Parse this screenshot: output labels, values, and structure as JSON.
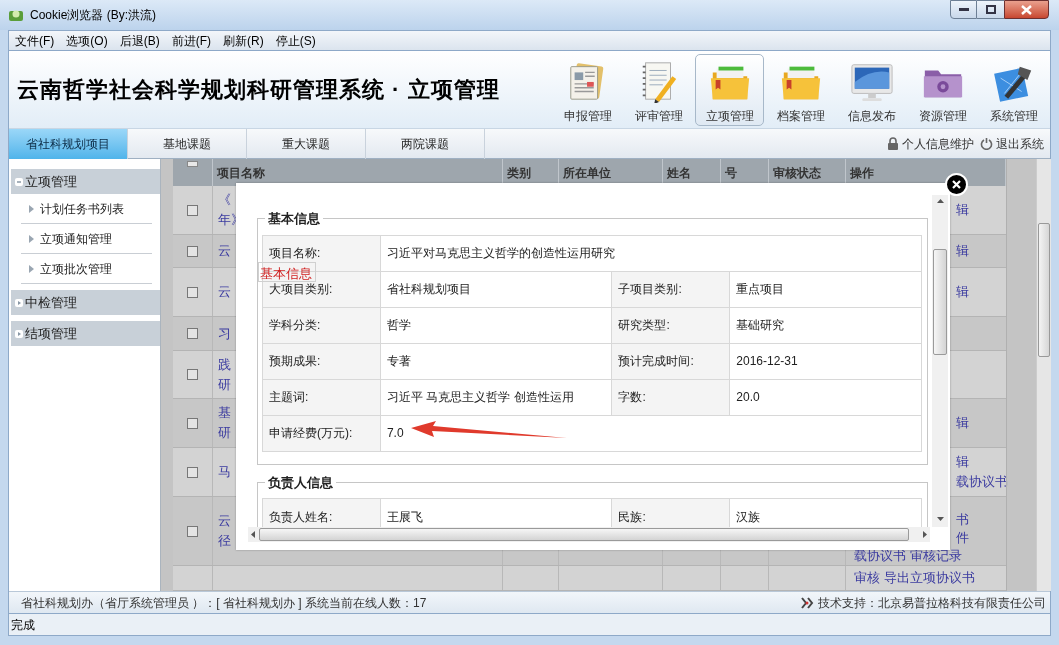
{
  "window": {
    "title": "Cookie浏览器 (By:洪流)"
  },
  "menu": [
    "文件(F)",
    "选项(O)",
    "后退(B)",
    "前进(F)",
    "刷新(R)",
    "停止(S)"
  ],
  "header": {
    "title": "云南哲学社会科学规划科研管理系统 · 立项管理",
    "nav": [
      {
        "label": "申报管理",
        "selected": false
      },
      {
        "label": "评审管理",
        "selected": false
      },
      {
        "label": "立项管理",
        "selected": true
      },
      {
        "label": "档案管理",
        "selected": false
      },
      {
        "label": "信息发布",
        "selected": false
      },
      {
        "label": "资源管理",
        "selected": false
      },
      {
        "label": "系统管理",
        "selected": false
      }
    ]
  },
  "tabs": [
    {
      "label": "省社科规划项目",
      "selected": true
    },
    {
      "label": "基地课题",
      "selected": false
    },
    {
      "label": "重大课题",
      "selected": false
    },
    {
      "label": "两院课题",
      "selected": false
    }
  ],
  "user_links": [
    "个人信息维护",
    "退出系统"
  ],
  "sidebar": [
    {
      "label": "立项管理",
      "expanded": true,
      "children": [
        {
          "label": "计划任务书列表"
        },
        {
          "label": "立项通知管理"
        },
        {
          "label": "立项批次管理"
        }
      ]
    },
    {
      "label": "中检管理",
      "expanded": false
    },
    {
      "label": "结项管理",
      "expanded": false
    }
  ],
  "table": {
    "select_all": {
      "checked": false
    },
    "columns": [
      "项目名称",
      "类别",
      "所在单位",
      "姓名",
      "号",
      "审核状态",
      "操作"
    ],
    "rows": [
      {
        "checked": false,
        "name": [
          "《",
          "年》"
        ],
        "ops": [
          {
            "text": "辑",
            "kind": "partial"
          }
        ]
      },
      {
        "checked": false,
        "name": [
          "云"
        ],
        "ops": [
          {
            "text": "辑",
            "kind": "partial"
          }
        ]
      },
      {
        "checked": false,
        "name": [
          "云"
        ],
        "ops": [
          {
            "text": "辑",
            "kind": "partial"
          }
        ]
      },
      {
        "checked": false,
        "name": [
          "习"
        ],
        "ops": []
      },
      {
        "checked": false,
        "name": [
          "践",
          "研"
        ],
        "ops": []
      },
      {
        "checked": false,
        "name": [
          "基",
          "研"
        ],
        "ops": [
          {
            "text": "辑",
            "kind": "partial"
          }
        ]
      },
      {
        "checked": false,
        "name": [
          "马"
        ],
        "ops": [
          {
            "text": "辑",
            "kind": "partial"
          },
          {
            "text": "载协议书",
            "kind": "partial"
          }
        ]
      },
      {
        "checked": false,
        "name": [
          "云",
          "径"
        ],
        "ops": [
          {
            "text": "书",
            "kind": "partial"
          },
          {
            "text": "件",
            "kind": "partial"
          },
          {
            "text": "载协议书  审核记录",
            "kind": "full"
          }
        ]
      },
      {
        "name": [],
        "ops": [
          {
            "text": "审核  导出立项协议书",
            "kind": "full"
          }
        ]
      }
    ]
  },
  "dialog": {
    "sections": [
      {
        "title": "基本信息",
        "rows": [
          [
            {
              "label": "项目名称:",
              "value": "习近平对马克思主义哲学的创造性运用研究"
            }
          ],
          [
            {
              "label": "大项目类别:",
              "value": "省社科规划项目"
            },
            {
              "label": "子项目类别:",
              "value": "重点项目"
            }
          ],
          [
            {
              "label": "学科分类:",
              "value": "哲学"
            },
            {
              "label": "研究类型:",
              "value": "基础研究"
            }
          ],
          [
            {
              "label": "预期成果:",
              "value": "专著"
            },
            {
              "label": "预计完成时间:",
              "value": "2016-12-31"
            }
          ],
          [
            {
              "label": "主题词:",
              "value": "习近平 马克思主义哲学 创造性运用"
            },
            {
              "label": "字数:",
              "value": "20.0"
            }
          ],
          [
            {
              "label": "申请经费(万元):",
              "value": "7.0"
            }
          ]
        ]
      },
      {
        "title": "负责人信息",
        "rows": [
          [
            {
              "label": "负责人姓名:",
              "value": "王展飞"
            },
            {
              "label": "民族:",
              "value": "汉族"
            }
          ]
        ]
      }
    ],
    "floating_tag": "基本信息"
  },
  "status_bar": {
    "text": "省社科规划办（省厅系统管理员 ）：[ 省社科规划办 ]  系统当前在线人数：17",
    "support": "技术支持：北京易普拉格科技有限责任公司"
  },
  "browser_status": "完成"
}
